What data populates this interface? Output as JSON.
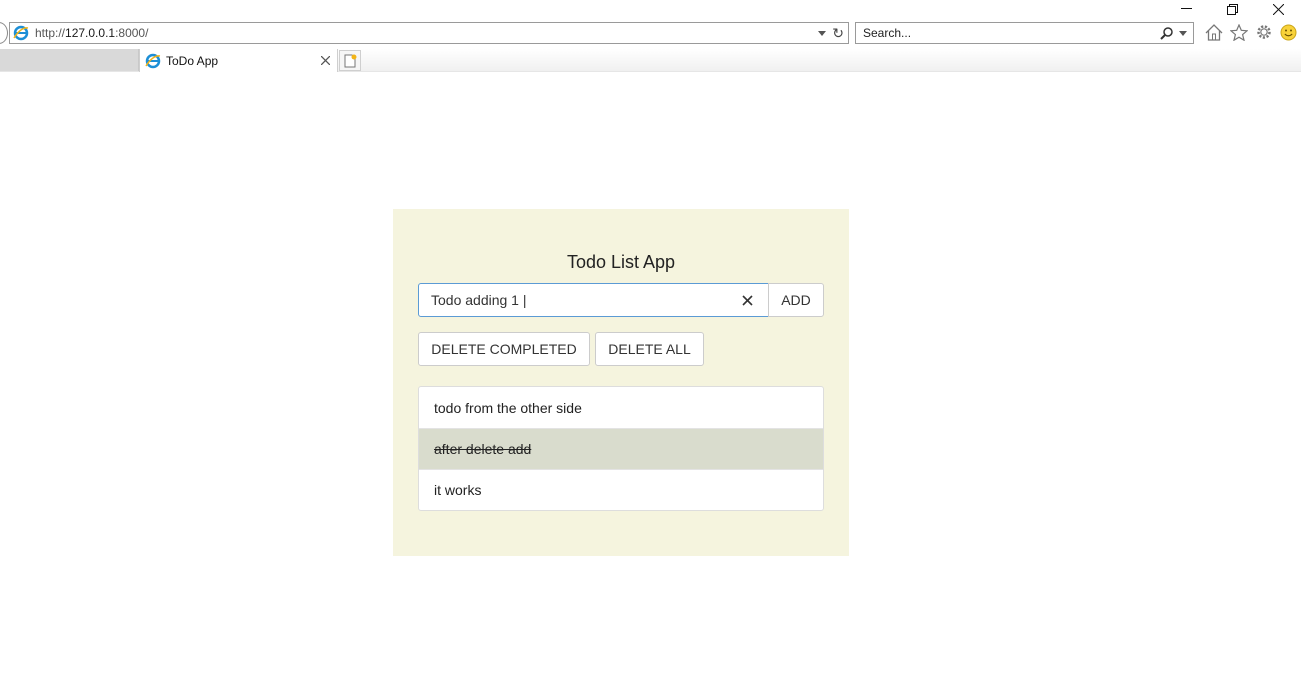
{
  "browser": {
    "url_prefix": "http://",
    "url_host": "127.0.0.1",
    "url_suffix": ":8000/",
    "search_placeholder": "Search...",
    "tab_title": "ToDo App"
  },
  "app": {
    "title": "Todo List App",
    "input_value": "Todo adding 1 |",
    "add_label": "ADD",
    "delete_completed_label": "DELETE COMPLETED",
    "delete_all_label": "DELETE ALL",
    "todos": [
      {
        "text": "todo from the other side",
        "completed": false
      },
      {
        "text": "after delete add",
        "completed": true
      },
      {
        "text": "it works",
        "completed": false
      }
    ]
  },
  "colors": {
    "panel_bg": "#f5f4de",
    "completed_bg": "#d9dccd",
    "input_focus_border": "#5b9bd5"
  }
}
